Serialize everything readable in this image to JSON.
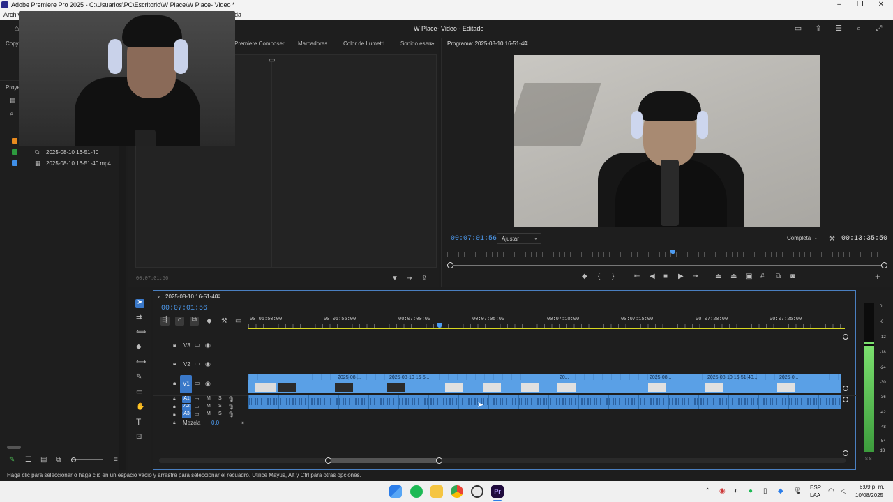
{
  "window": {
    "title": "Adobe Premiere Pro 2025 - C:\\Usuarios\\PC\\Escritorio\\W Place\\W Place- Video *",
    "menu_first": "Archivo",
    "menu_last": "da"
  },
  "header": {
    "project_title": "W Place- Video",
    "status": "- Editado"
  },
  "left_panel": {
    "tab_copy": "Copy",
    "tab_project": "Proye",
    "items": [
      {
        "label": "2025-08-10 16-51-40",
        "color": "#2d9a3e"
      },
      {
        "label": "2025-08-10 16-51-40.mp4",
        "color": "#3f8fe8"
      }
    ],
    "bin_color": "#e88a1e"
  },
  "source_panel": {
    "tabs": [
      "Premiere Composer",
      "Marcadores",
      "Color de Lumetri",
      "Sonido esen"
    ],
    "timecode": "00:07:01:56"
  },
  "program": {
    "label": "Programa: 2025-08-10 16-51-40",
    "timecode": "00:07:01:56",
    "fit": "Ajustar",
    "quality": "Completa",
    "duration": "00:13:35:50"
  },
  "timeline": {
    "sequence": "2025-08-10 16-51-40",
    "timecode": "00:07:01:56",
    "ruler": [
      "00:06:50:00",
      "00:06:55:00",
      "00:07:00:00",
      "00:07:05:00",
      "00:07:10:00",
      "00:07:15:00",
      "00:07:20:00",
      "00:07:25:00"
    ],
    "video_tracks": [
      "V3",
      "V2",
      "V1"
    ],
    "audio_tracks": [
      "A1",
      "A2",
      "A3"
    ],
    "mix_label": "Mezcla",
    "mix_value": "0,0",
    "clip_labels": [
      "2025-08-...",
      "2025-08-10 16-5...",
      "20...",
      "2025-08...",
      "2025-08-10 16-51-40...",
      "2025-0..."
    ],
    "audio_mute": "M",
    "audio_solo": "S"
  },
  "meter": {
    "scale": [
      "0",
      "-6",
      "-12",
      "-18",
      "-24",
      "-30",
      "-36",
      "-42",
      "-48",
      "-54",
      "dB"
    ],
    "solo_labels": "S  S"
  },
  "status_bar": {
    "text": "Haga clic para seleccionar o haga clic en un espacio vacío y arrastre para seleccionar el recuadro. Utilice Mayús, Alt y Ctrl para otras opciones."
  },
  "taskbar": {
    "lang": "ESP",
    "lang2": "LAA",
    "time": "6:09 p. m.",
    "date": "10/08/2025",
    "app_premiere": "Pr"
  }
}
